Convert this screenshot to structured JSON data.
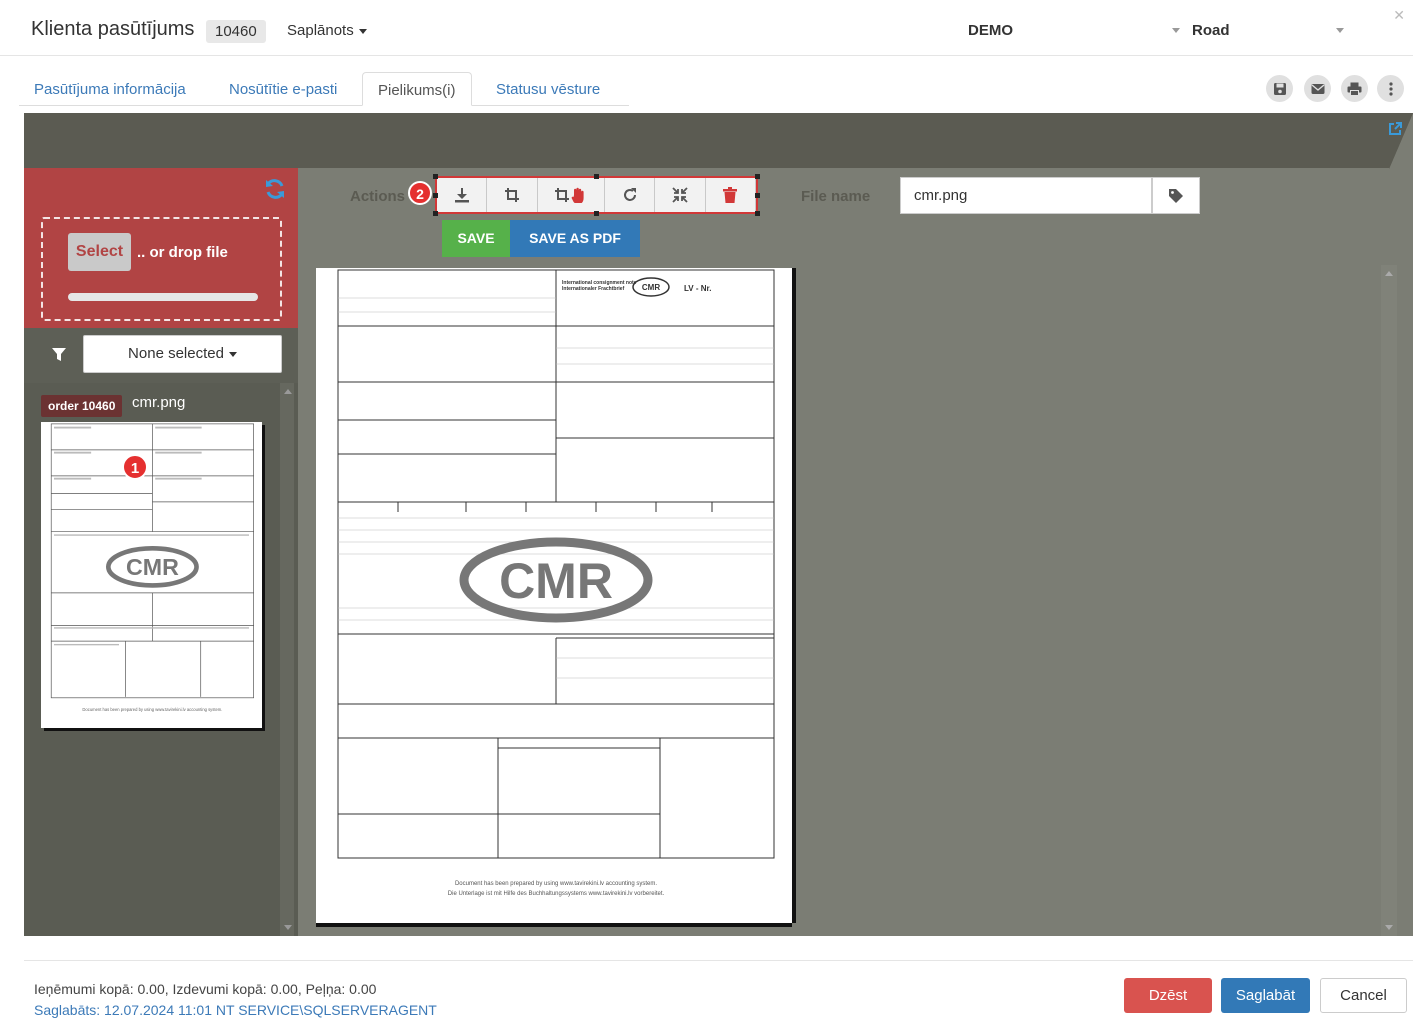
{
  "header": {
    "title": "Klienta pasūtījums",
    "order_number": "10460",
    "status": "Saplānots",
    "company": "DEMO",
    "transport": "Road"
  },
  "tabs": [
    {
      "label": "Pasūtījuma informācija",
      "active": false
    },
    {
      "label": "Nosūtītie e-pasti",
      "active": false
    },
    {
      "label": "Pielikums(i)",
      "active": true
    },
    {
      "label": "Statusu vēsture",
      "active": false
    }
  ],
  "toolbar_icons": [
    "save-icon",
    "email-icon",
    "print-icon",
    "more-icon"
  ],
  "upload": {
    "select_label": "Select",
    "drop_text": ".. or drop file"
  },
  "filter": {
    "selected": "None selected"
  },
  "attachments": [
    {
      "order_tag": "order 10460",
      "file_name": "cmr.png"
    }
  ],
  "annotations": {
    "badge1": "1",
    "badge2": "2"
  },
  "editor": {
    "actions_label": "Actions",
    "action_icons": [
      "download-icon",
      "crop-icon",
      "crop-hand-icon",
      "rotate-icon",
      "compress-icon",
      "delete-icon"
    ],
    "save_label": "SAVE",
    "save_pdf_label": "SAVE AS PDF",
    "file_name_label": "File name",
    "file_name_value": "cmr.png"
  },
  "document": {
    "stamp": "CMR",
    "header_title": "International consignment note",
    "header_sub": "Internationaler Frachtbrief",
    "lv_nr": "LV - Nr.",
    "footer_line1": "Document has been prepared by using www.tavirekini.lv accounting system.",
    "footer_line2": "Die Unterlage ist mit Hilfe des Buchhaltungssystems www.tavirekini.lv vorbereitet."
  },
  "footer": {
    "totals": "Ieņēmumi kopā: 0.00, Izdevumi kopā: 0.00, Peļņa: 0.00",
    "saved": "Saglabāts: 12.07.2024 11:01 NT SERVICE\\SQLSERVERAGENT",
    "delete_label": "Dzēst",
    "save_label": "Saglabāt",
    "cancel_label": "Cancel"
  },
  "colors": {
    "accent_blue": "#3279b7",
    "danger_red": "#d9534f",
    "upload_red": "#b14444",
    "save_green": "#56b14a",
    "panel_gray": "#7b7d74"
  }
}
